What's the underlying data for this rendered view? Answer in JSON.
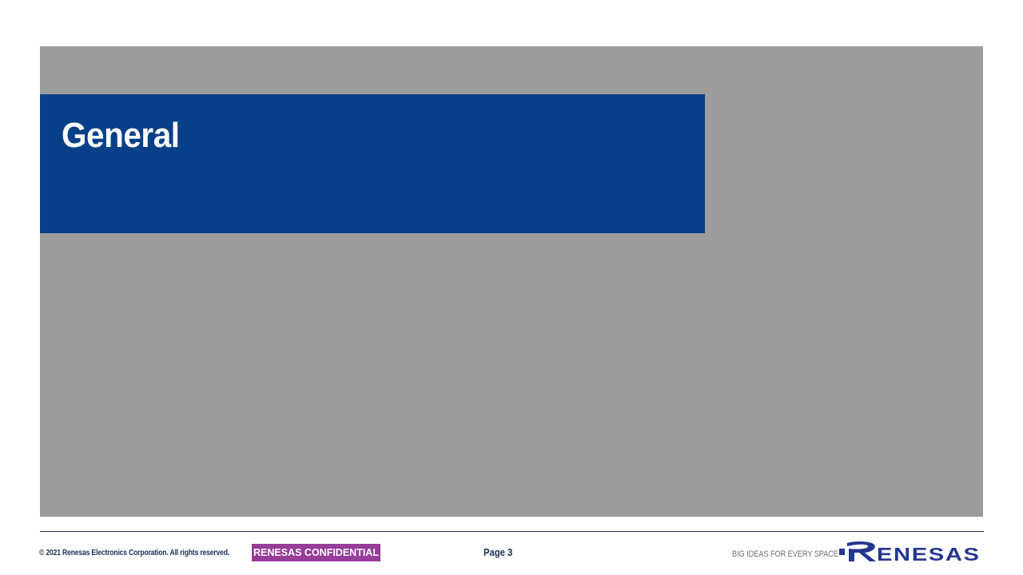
{
  "slide": {
    "title": "General"
  },
  "footer": {
    "copyright": "© 2021 Renesas Electronics Corporation. All rights reserved.",
    "confidential_label": "RENESAS CONFIDENTIAL",
    "page_label": "Page 3",
    "tagline": "BIG IDEAS FOR EVERY SPACE",
    "logo_text": "RENESAS"
  },
  "colors": {
    "title_banner": "#074088",
    "content_panel": "#9c9c9c",
    "confidential_badge": "#973c98",
    "logo": "#24378f"
  }
}
